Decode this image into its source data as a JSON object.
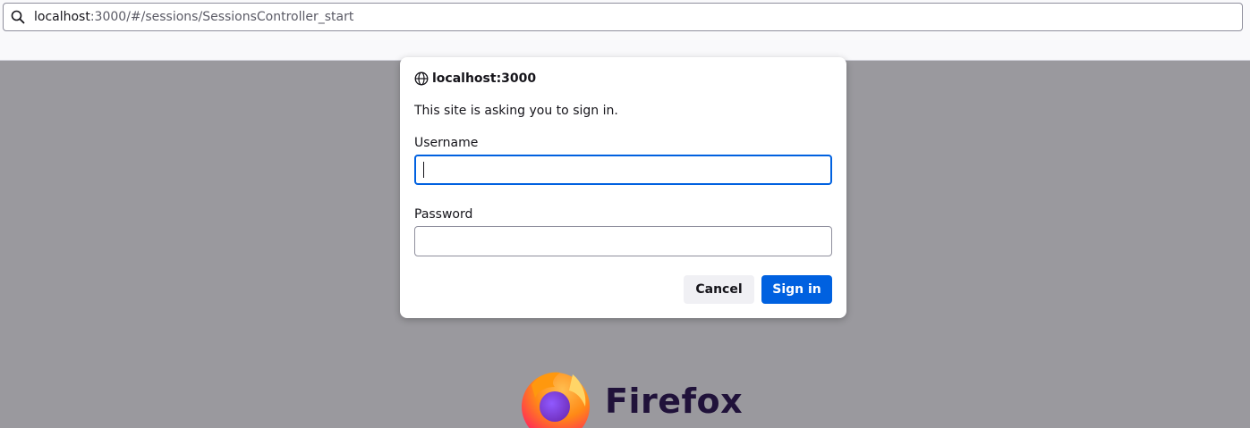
{
  "urlbar": {
    "url_host": "localhost",
    "url_rest": ":3000/#/sessions/SessionsController_start",
    "search_icon": "search-icon"
  },
  "dialog": {
    "host": "localhost:3000",
    "host_icon": "globe-icon",
    "message": "This site is asking you to sign in.",
    "username_label": "Username",
    "username_value": "",
    "password_label": "Password",
    "password_value": "",
    "cancel_label": "Cancel",
    "signin_label": "Sign in"
  },
  "branding": {
    "wordmark": "Firefox"
  },
  "colors": {
    "accent": "#0061e0",
    "overlay": "#9a999e",
    "wordmark": "#20123a"
  }
}
